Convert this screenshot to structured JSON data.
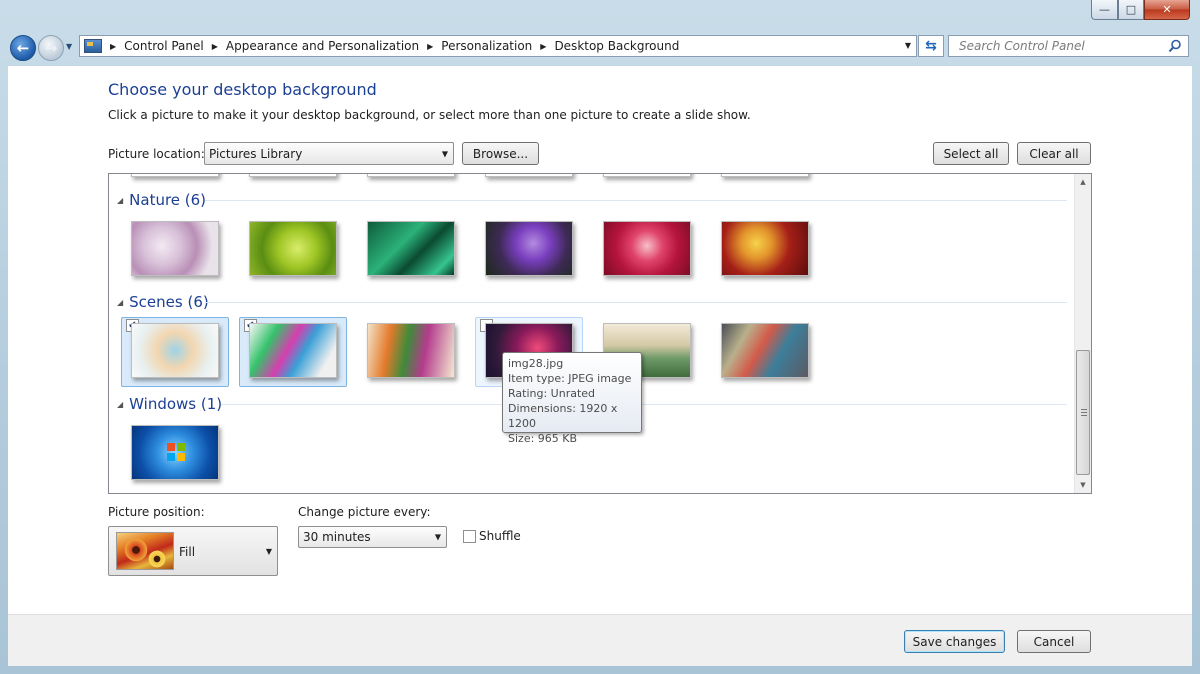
{
  "window": {
    "minimize_glyph": "—",
    "maximize_glyph": "□",
    "close_glyph": "✕"
  },
  "nav": {
    "back_glyph": "←",
    "forward_glyph": "→"
  },
  "address": {
    "crumbs": [
      "Control Panel",
      "Appearance and Personalization",
      "Personalization",
      "Desktop Background"
    ]
  },
  "search": {
    "placeholder": "Search Control Panel"
  },
  "page": {
    "heading": "Choose your desktop background",
    "subtext": "Click a picture to make it your desktop background, or select more than one picture to create a slide show.",
    "location_label": "Picture location:",
    "location_value": "Pictures Library",
    "browse_label": "Browse...",
    "select_all_label": "Select all",
    "clear_all_label": "Clear all"
  },
  "gallery": {
    "groups": [
      {
        "title": "Nature (6)"
      },
      {
        "title": "Scenes (6)"
      },
      {
        "title": "Windows (1)"
      }
    ]
  },
  "tooltip": {
    "name": "img28.jpg",
    "item_type": "Item type: JPEG image",
    "rating": "Rating: Unrated",
    "dimensions": "Dimensions: 1920 x 1200",
    "size": "Size: 965 KB"
  },
  "options": {
    "position_label": "Picture position:",
    "position_value": "Fill",
    "interval_label": "Change picture every:",
    "interval_value": "30 minutes",
    "shuffle_label": "Shuffle"
  },
  "footer": {
    "save_label": "Save changes",
    "cancel_label": "Cancel"
  },
  "colors": {
    "heading": "#1c3f94",
    "selection": "#d9ebfb",
    "close_button": "#c75a41"
  }
}
